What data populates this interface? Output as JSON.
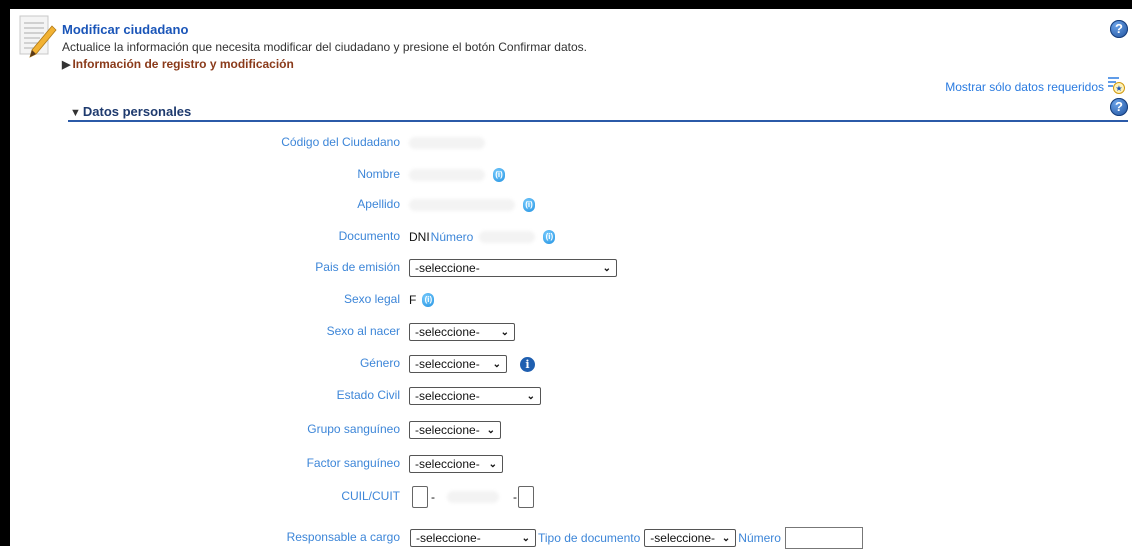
{
  "header": {
    "title": "Modificar ciudadano",
    "description": "Actualice la información que necesita modificar del ciudadano y presione el botón Confirmar datos.",
    "registro_link": "Información de registro y modificación",
    "help_icon": "question-circle-icon"
  },
  "toolbar": {
    "mostrar_requeridos": "Mostrar sólo datos requeridos",
    "mostrar_icon": "list-star-icon"
  },
  "section": {
    "title": "Datos personales",
    "toggle_icon": "triangle-down-icon"
  },
  "fields": {
    "codigo": {
      "label": "Código del Ciudadano"
    },
    "nombre": {
      "label": "Nombre",
      "badge": "(i)"
    },
    "apellido": {
      "label": "Apellido",
      "badge": "(i)"
    },
    "documento": {
      "label": "Documento",
      "tipo": "DNI",
      "numero_label": "Número",
      "badge": "(i)"
    },
    "pais_emision": {
      "label": "Pais de emisión",
      "value": "-seleccione-"
    },
    "sexo_legal": {
      "label": "Sexo legal",
      "value": "F",
      "badge": "(i)"
    },
    "sexo_nacer": {
      "label": "Sexo al nacer",
      "value": "-seleccione-"
    },
    "genero": {
      "label": "Género",
      "value": "-seleccione-",
      "info": "i"
    },
    "estado_civil": {
      "label": "Estado Civil",
      "value": "-seleccione-"
    },
    "grupo_sanguineo": {
      "label": "Grupo sanguíneo",
      "value": "-seleccione-"
    },
    "factor_sanguineo": {
      "label": "Factor sanguíneo",
      "value": "-seleccione-"
    },
    "cuil": {
      "label": "CUIL/CUIT",
      "sep1": "-",
      "sep2": "-"
    },
    "responsable": {
      "label": "Responsable a cargo",
      "value": "-seleccione-",
      "tipo_doc_label": "Tipo de documento",
      "tipo_doc_value": "-seleccione-",
      "numero_label": "Número"
    }
  },
  "colors": {
    "label": "#3d86d8",
    "title": "#1a55b8",
    "section": "#1e3a6e",
    "link": "#8a3a1a"
  }
}
